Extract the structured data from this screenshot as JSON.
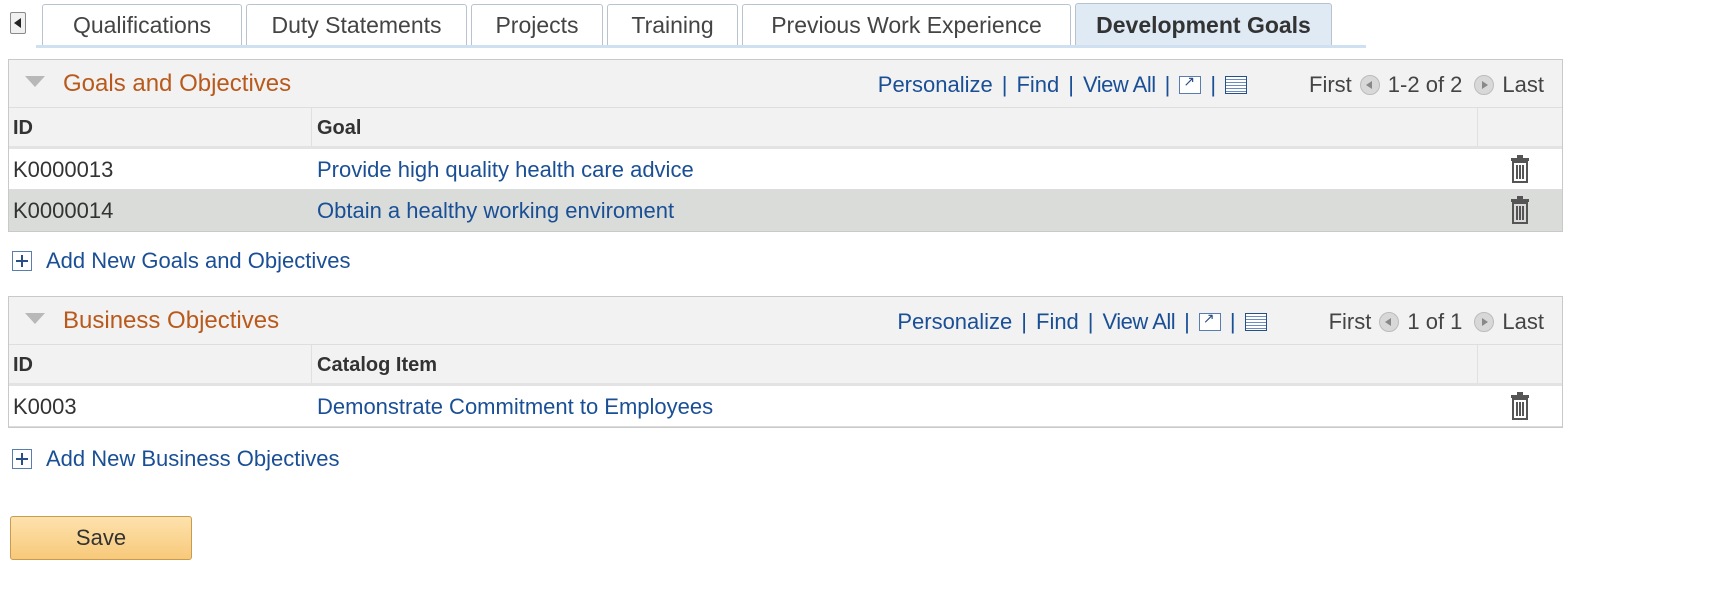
{
  "tabs": [
    {
      "label": "Qualifications"
    },
    {
      "label": "Duty Statements"
    },
    {
      "label": "Projects"
    },
    {
      "label": "Training"
    },
    {
      "label": "Previous Work Experience"
    },
    {
      "label": "Development Goals",
      "active": true
    }
  ],
  "toolbar": {
    "personalize": "Personalize",
    "find": "Find",
    "view_all": "View All",
    "separator": "|",
    "first": "First",
    "last": "Last"
  },
  "goals": {
    "title": "Goals and Objectives",
    "range": "1-2 of 2",
    "columns": {
      "id": "ID",
      "name": "Goal"
    },
    "rows": [
      {
        "id": "K0000013",
        "name": "Provide high quality health care advice"
      },
      {
        "id": "K0000014",
        "name": "Obtain a healthy working enviroment"
      }
    ],
    "add_label": "Add New Goals and Objectives"
  },
  "business": {
    "title": "Business Objectives",
    "range": "1 of 1",
    "columns": {
      "id": "ID",
      "name": "Catalog Item"
    },
    "rows": [
      {
        "id": "K0003",
        "name": "Demonstrate Commitment to Employees"
      }
    ],
    "add_label": "Add New Business Objectives"
  },
  "save_label": "Save",
  "icons": {
    "tab_scroll": "tab-scroll-left-icon",
    "collapse": "collapse-triangle-icon",
    "zoom": "new-window-icon",
    "download": "download-spreadsheet-icon",
    "prev": "previous-row-icon",
    "next": "next-row-icon",
    "delete": "trash-icon",
    "add": "plus-icon"
  },
  "colors": {
    "section_title": "#b9591b",
    "link": "#1a4f96",
    "save_button": "#f8c97a",
    "active_tab": "#dfeaf5"
  }
}
